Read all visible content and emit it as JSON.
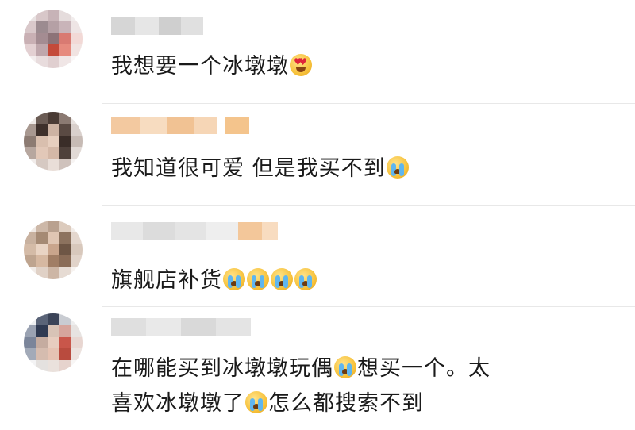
{
  "comments": [
    {
      "text_parts": [
        "我想要一个冰墩墩"
      ],
      "emojis": [
        "heart-eyes"
      ]
    },
    {
      "text_parts": [
        "我知道很可爱 但是我买不到"
      ],
      "emojis": [
        "crying"
      ]
    },
    {
      "text_parts": [
        "旗舰店补货"
      ],
      "emojis": [
        "crying",
        "crying",
        "crying",
        "crying"
      ]
    },
    {
      "line1_a": "在哪能买到冰墩墩玩偶",
      "line1_b": "想买一个。太",
      "line2_a": "喜欢冰墩墩了",
      "line2_b": "怎么都搜索不到",
      "emojis": [
        "crying",
        "crying"
      ]
    }
  ],
  "colors": {
    "text": "#1a1a1a",
    "divider": "#e8e8e8",
    "name_blur_gray": "#d9d9d9",
    "name_blur_orange": "#f4c48c"
  }
}
